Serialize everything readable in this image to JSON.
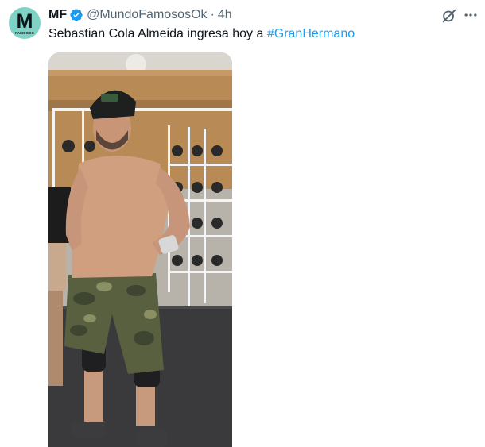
{
  "tweet": {
    "author": {
      "avatar_letter": "M",
      "avatar_subtext": "FAMOSOS",
      "avatar_color": "#7fd3c6",
      "display_name": "MF",
      "verified": true,
      "handle": "@MundoFamososOk",
      "separator": "·",
      "time": "4h"
    },
    "text": "Sebastian Cola Almeida ingresa hoy a ",
    "hashtag": "#GranHermano",
    "icons": {
      "verified": "verified-badge-icon",
      "grok": "grok-icon",
      "more": "more-options-icon"
    },
    "media": {
      "type": "photo"
    },
    "colors": {
      "text": "#0f1419",
      "secondary": "#536471",
      "link": "#1d9bf0"
    }
  }
}
